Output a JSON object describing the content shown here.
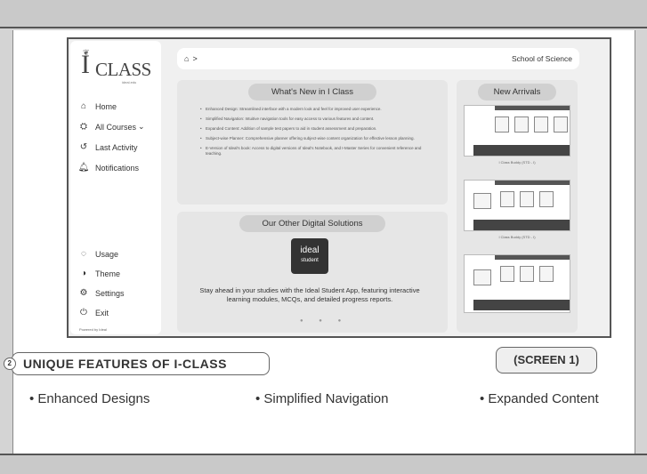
{
  "app": {
    "logo_letter": "I",
    "logo_word": "CLASS",
    "logo_tag": "ideal.edu",
    "credit": "Powered by Ideal"
  },
  "sidebar": {
    "items": [
      {
        "label": "Home",
        "icon": "home-icon",
        "glyph": "⌂"
      },
      {
        "label": "All Courses",
        "icon": "graduation-cap-icon",
        "glyph": "⛭",
        "chevron": "⌄"
      },
      {
        "label": "Last Activity",
        "icon": "history-icon",
        "glyph": "↺"
      },
      {
        "label": "Notifications",
        "icon": "bell-icon",
        "glyph": "♫"
      }
    ],
    "bottom_items": [
      {
        "label": "Usage",
        "icon": "usage-icon",
        "glyph": "◌"
      },
      {
        "label": "Theme",
        "icon": "theme-icon",
        "glyph": "◑"
      },
      {
        "label": "Settings",
        "icon": "gear-icon",
        "glyph": "⚙"
      },
      {
        "label": "Exit",
        "icon": "power-icon",
        "glyph": "⏻"
      }
    ]
  },
  "breadcrumb": {
    "home_glyph": "⌂",
    "separator": ">",
    "school": "School of Science"
  },
  "whats_new": {
    "title": "What's New in I Class",
    "items": [
      "Enhanced Design: Streamlined interface with a modern look and feel for improved user experience.",
      "Simplified Navigation: Intuitive navigation tools for easy access to various features and content.",
      "Expanded Content: Addition of sample test papers to aid in student assessment and preparation.",
      "Subject-wise Planner: Comprehensive planner offering subject-wise content organization for effective lesson planning.",
      "E-Version of Ideal's book: Access to digital versions of Ideal's Notebook, and I-Master Series for convenient reference and teaching."
    ]
  },
  "digital_solutions": {
    "title": "Our Other Digital Solutions",
    "app_logo_line1": "ideal",
    "app_logo_line2": "student",
    "text": "Stay ahead in your studies with the Ideal Student App, featuring interactive learning modules, MCQs, and detailed progress reports.",
    "dots": "● ● ●"
  },
  "new_arrivals": {
    "title": "New Arrivals",
    "books": [
      {
        "caption": "I Class Buddy (STD - I)"
      },
      {
        "caption": "I Class Buddy (STD - I)"
      },
      {
        "caption": ""
      }
    ]
  },
  "caption": {
    "number": "2",
    "unique_title": "UNIQUE FEATURES OF I-CLASS",
    "screen_label": "(SCREEN 1)"
  },
  "features": [
    "Enhanced Designs",
    "Simplified Navigation",
    "Expanded Content"
  ],
  "colors": {
    "page_bg": "#ffffff",
    "band_bg": "#c9c9c9",
    "panel_bg": "#e6e6e6",
    "pill_bg": "#d0d0d0"
  }
}
